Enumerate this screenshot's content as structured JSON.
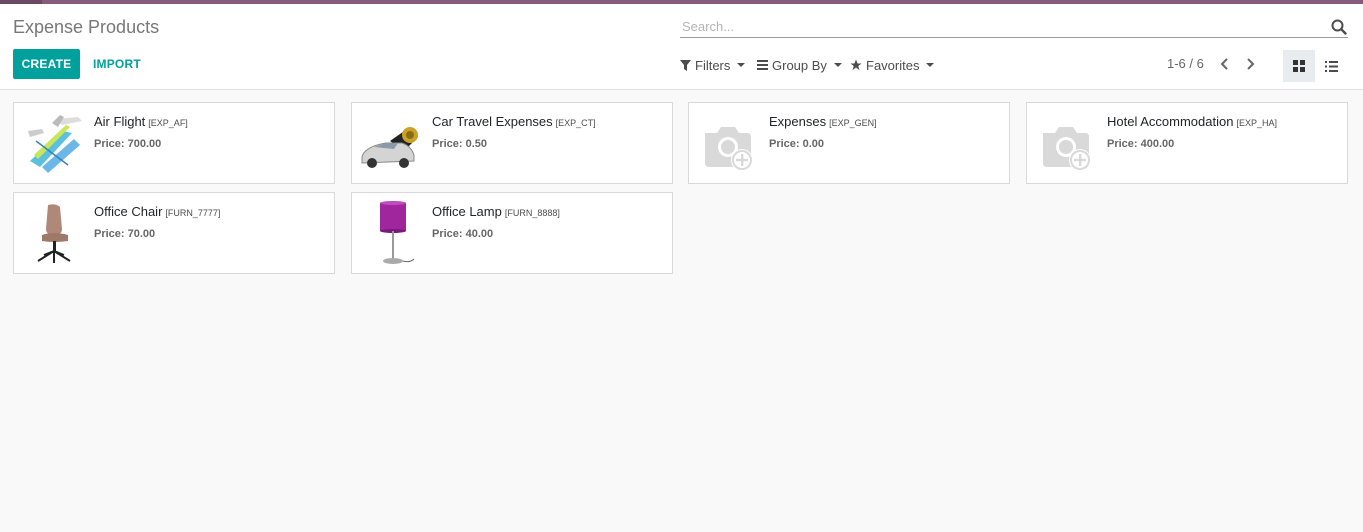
{
  "header": {
    "title": "Expense Products"
  },
  "search": {
    "placeholder": "Search..."
  },
  "buttons": {
    "create": "CREATE",
    "import": "IMPORT"
  },
  "filters": {
    "filters_label": "Filters",
    "groupby_label": "Group By",
    "favorites_label": "Favorites"
  },
  "pager": {
    "text": "1-6 / 6"
  },
  "colors": {
    "brand": "#875a7b",
    "primary": "#00a09d"
  },
  "products": [
    {
      "name": "Air Flight",
      "code": "[EXP_AF]",
      "price": "Price: 700.00",
      "image": "air-flight-image"
    },
    {
      "name": "Car Travel Expenses",
      "code": "[EXP_CT]",
      "price": "Price: 0.50",
      "image": "car-image"
    },
    {
      "name": "Expenses",
      "code": "[EXP_GEN]",
      "price": "Price: 0.00",
      "image": "camera-placeholder-icon"
    },
    {
      "name": "Hotel Accommodation",
      "code": "[EXP_HA]",
      "price": "Price: 400.00",
      "image": "camera-placeholder-icon"
    },
    {
      "name": "Office Chair",
      "code": "[FURN_7777]",
      "price": "Price: 70.00",
      "image": "office-chair-image"
    },
    {
      "name": "Office Lamp",
      "code": "[FURN_8888]",
      "price": "Price: 40.00",
      "image": "office-lamp-image"
    }
  ]
}
